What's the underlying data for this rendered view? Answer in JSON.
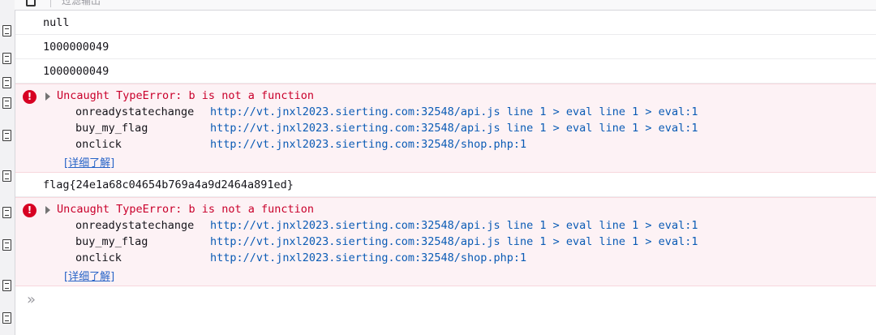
{
  "toolbar": {
    "filter_placeholder": "过滤输出"
  },
  "log": {
    "row1": "null",
    "row2": "1000000049",
    "row3": "1000000049",
    "error1": {
      "message": "Uncaught TypeError: b is not a function",
      "frames": [
        {
          "fn": "onreadystatechange",
          "loc": "http://vt.jnxl2023.sierting.com:32548/api.js line 1 > eval line 1 > eval:1"
        },
        {
          "fn": "buy_my_flag",
          "loc": "http://vt.jnxl2023.sierting.com:32548/api.js line 1 > eval line 1 > eval:1"
        },
        {
          "fn": "onclick",
          "loc": "http://vt.jnxl2023.sierting.com:32548/shop.php:1"
        }
      ],
      "learn_more": "[详细了解]"
    },
    "flag": "flag{24e1a68c04654b769a4a9d2464a891ed}",
    "error2": {
      "message": "Uncaught TypeError: b is not a function",
      "frames": [
        {
          "fn": "onreadystatechange",
          "loc": "http://vt.jnxl2023.sierting.com:32548/api.js line 1 > eval line 1 > eval:1"
        },
        {
          "fn": "buy_my_flag",
          "loc": "http://vt.jnxl2023.sierting.com:32548/api.js line 1 > eval line 1 > eval:1"
        },
        {
          "fn": "onclick",
          "loc": "http://vt.jnxl2023.sierting.com:32548/shop.php:1"
        }
      ],
      "learn_more": "[详细了解]"
    }
  },
  "input": {
    "prompt": "»"
  },
  "icons": {
    "error": "error-icon",
    "trash": "trash-icon",
    "doc": "document-icon"
  },
  "colors": {
    "error_text": "#c9002b",
    "error_bg": "#fdf2f5",
    "link": "#0a5bb5"
  }
}
